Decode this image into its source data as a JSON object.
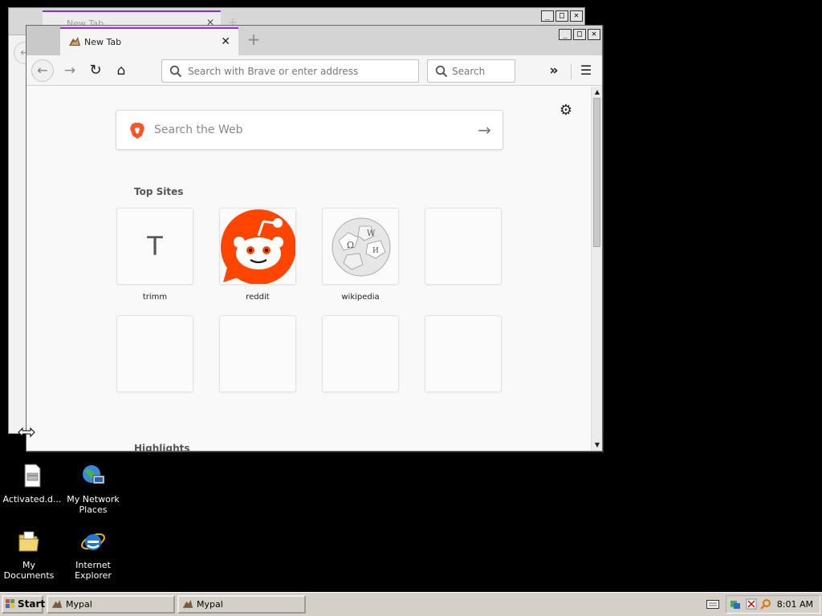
{
  "background_window": {
    "tab_title": "New Tab"
  },
  "window": {
    "tab_title": "New Tab",
    "close_glyph": "✕",
    "newtab_glyph": "+",
    "controls": [
      "_",
      "□",
      "✕"
    ]
  },
  "toolbar": {
    "back_glyph": "←",
    "forward_glyph": "→",
    "reload_glyph": "↻",
    "home_glyph": "⌂",
    "url_placeholder": "Search with Brave or enter address",
    "search_placeholder": "Search",
    "overflow_glyph": "»",
    "menu_glyph": "☰"
  },
  "newtab_page": {
    "settings_glyph": "⚙",
    "websearch_placeholder": "Search the Web",
    "websearch_arrow": "→",
    "top_sites_title": "Top Sites",
    "highlights_title": "Highlights",
    "tiles": [
      {
        "label": "trimm",
        "letter": "T",
        "icon": "letter-icon"
      },
      {
        "label": "reddit",
        "icon": "reddit-icon"
      },
      {
        "label": "wikipedia",
        "icon": "wikipedia-icon"
      },
      {
        "label": "",
        "icon": ""
      },
      {
        "label": "",
        "icon": ""
      },
      {
        "label": "",
        "icon": ""
      },
      {
        "label": "",
        "icon": ""
      },
      {
        "label": "",
        "icon": ""
      }
    ]
  },
  "desktop": {
    "icons": [
      {
        "label": "Activated.d...",
        "icon": "document-icon"
      },
      {
        "label": "My Network Places",
        "icon": "network-places-icon"
      },
      {
        "label": "My Documents",
        "icon": "folder-icon"
      },
      {
        "label": "Internet Explorer",
        "icon": "internet-explorer-icon"
      }
    ]
  },
  "taskbar": {
    "start_label": "Start",
    "items": [
      "Mypal",
      "Mypal"
    ],
    "clock": "8:01 AM"
  },
  "colors": {
    "tab_accent": "#9b30c8",
    "brave_orange": "#fb542b",
    "reddit_orange": "#ff4500"
  }
}
